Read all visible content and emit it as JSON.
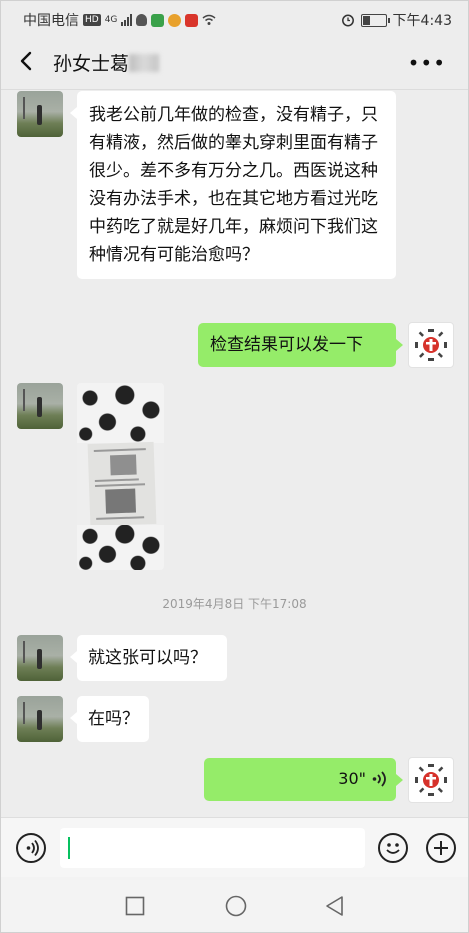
{
  "status_bar": {
    "carrier": "中国电信",
    "hd": "HD",
    "network": "4G",
    "time": "下午4:43"
  },
  "header": {
    "title": "孙女士葛",
    "more": "•••"
  },
  "messages": [
    {
      "side": "in",
      "text": "我老公前几年做的检查，没有精子，只有精液，然后做的睾丸穿刺里面有精子很少。差不多有万分之几。西医说这种没有办法手术，也在其它地方看过光吃中药吃了就是好几年，麻烦问下我们这种情况有可能治愈吗？"
    },
    {
      "side": "out",
      "text": "检查结果可以发一下"
    },
    {
      "side": "in",
      "type": "image"
    },
    {
      "side": "in",
      "text": "就这张可以吗？"
    },
    {
      "side": "in",
      "text": "在吗？"
    },
    {
      "side": "out",
      "type": "voice",
      "duration": "30\""
    }
  ],
  "timestamp": "2019年4月8日 下午17:08",
  "input": {
    "placeholder": ""
  },
  "icons": {
    "back": "back-arrow-icon",
    "voice_toggle": "voice-mode-icon",
    "emoji": "emoji-icon",
    "plus": "plus-icon",
    "nav_recents": "square-nav-icon",
    "nav_home": "circle-nav-icon",
    "nav_back": "triangle-nav-icon"
  },
  "colors": {
    "outgoing_bubble": "#95ec69",
    "incoming_bubble": "#ffffff",
    "chat_background": "#ededed",
    "cursor": "#07c160"
  }
}
